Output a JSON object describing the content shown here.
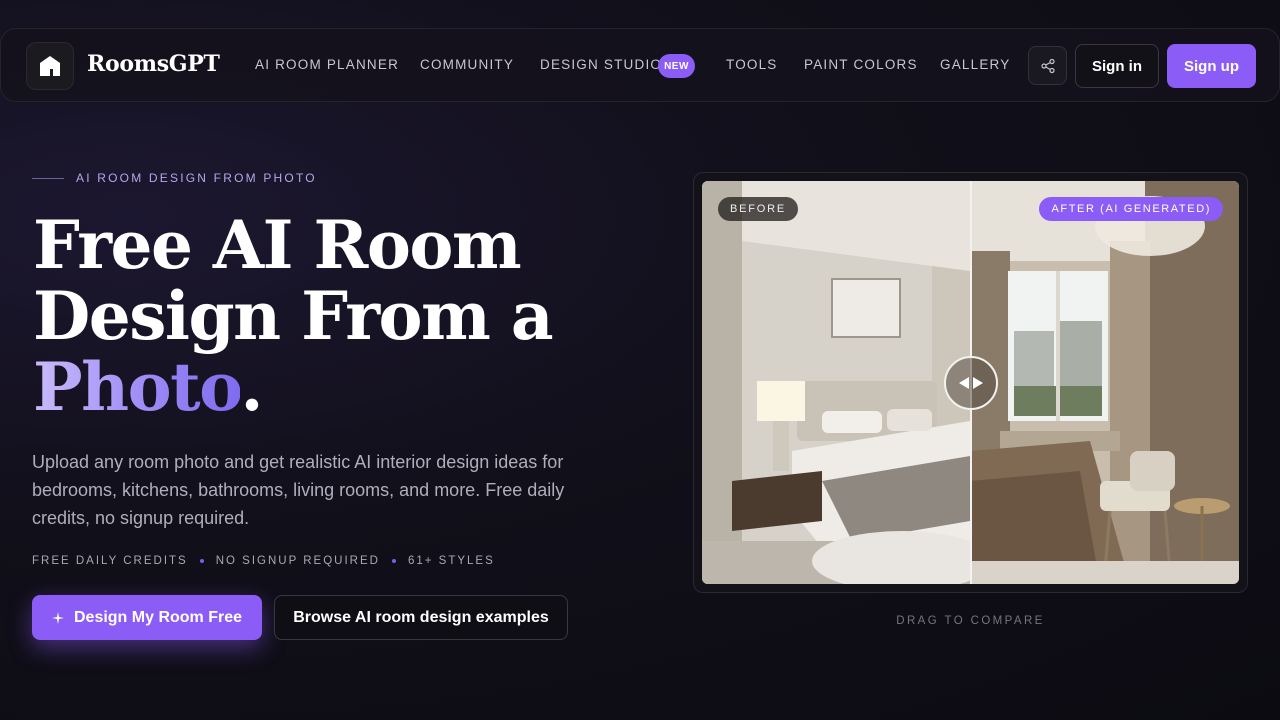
{
  "header": {
    "brand": "RoomsGPT",
    "nav": [
      {
        "label": "AI ROOM PLANNER"
      },
      {
        "label": "COMMUNITY"
      },
      {
        "label": "DESIGN STUDIO",
        "badge": "NEW"
      },
      {
        "label": "TOOLS"
      },
      {
        "label": "PAINT COLORS"
      },
      {
        "label": "GALLERY"
      }
    ],
    "share_icon": "share-icon",
    "sign_in": "Sign in",
    "sign_up": "Sign up"
  },
  "hero": {
    "eyebrow": "AI ROOM DESIGN FROM PHOTO",
    "headline_line1": "Free AI Room",
    "headline_line2": "Design From a",
    "headline_accent": "Photo",
    "headline_punct": ".",
    "subtext": "Upload any room photo and get realistic AI interior design ideas for bedrooms, kitchens, bathrooms, living rooms, and more. Free daily credits, no signup required.",
    "features": [
      "FREE DAILY CREDITS",
      "NO SIGNUP REQUIRED",
      "61+ STYLES"
    ],
    "cta_primary": "Design My Room Free",
    "cta_secondary": "Browse AI room design examples"
  },
  "compare": {
    "before_label": "BEFORE",
    "after_label": "AFTER (AI GENERATED)",
    "hint": "DRAG TO COMPARE"
  },
  "colors": {
    "accent": "#8b5cf6",
    "background": "#110f19"
  }
}
